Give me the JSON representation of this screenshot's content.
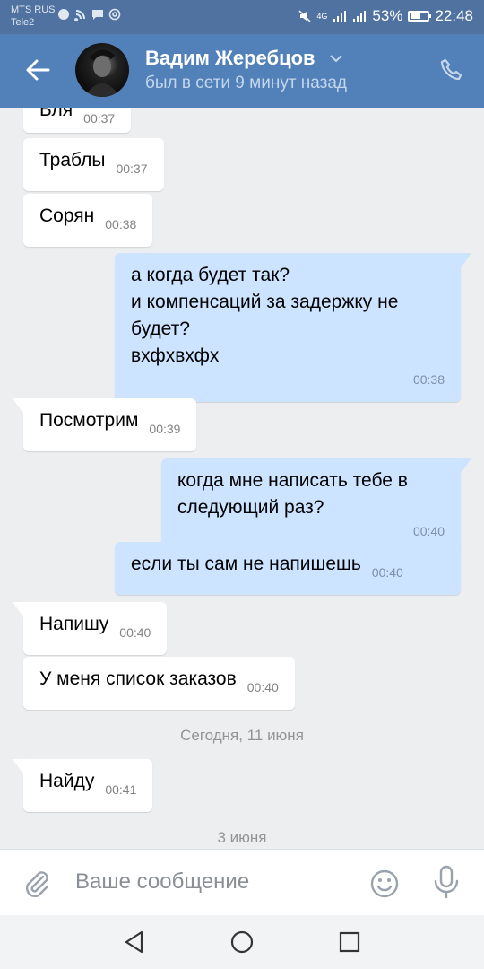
{
  "status_bar": {
    "carrier1": "MTS RUS",
    "carrier2": "Tele2",
    "network": "4G",
    "battery": "53%",
    "battery_level": 0.53,
    "time": "22:48"
  },
  "header": {
    "name": "Вадим Жеребцов",
    "status": "был в сети 9 минут назад"
  },
  "messages": [
    {
      "dir": "in",
      "text": "Бля",
      "time": "00:37"
    },
    {
      "dir": "in",
      "text": "Траблы",
      "time": "00:37"
    },
    {
      "dir": "in",
      "text": "Сорян",
      "time": "00:38"
    },
    {
      "dir": "out",
      "text": "а когда будет так?\nи компенсаций за задержку не\nбудет?\nвхфхвхфх",
      "time": "00:38"
    },
    {
      "dir": "in",
      "text": "Посмотрим",
      "time": "00:39"
    },
    {
      "dir": "out",
      "text": "когда мне написать тебе в\nследующий раз?",
      "time": "00:40"
    },
    {
      "dir": "out",
      "text": "если ты сам не напишешь",
      "time": "00:40"
    },
    {
      "dir": "in",
      "text": "Напишу",
      "time": "00:40"
    },
    {
      "dir": "in",
      "text": "У меня список заказов",
      "time": "00:40"
    },
    {
      "dir": "in",
      "text": "Найду",
      "time": "00:41"
    }
  ],
  "date_separators": {
    "today": "Сегодня, 11 июня",
    "june3": "3 июня"
  },
  "composer": {
    "placeholder": "Ваше сообщение"
  }
}
